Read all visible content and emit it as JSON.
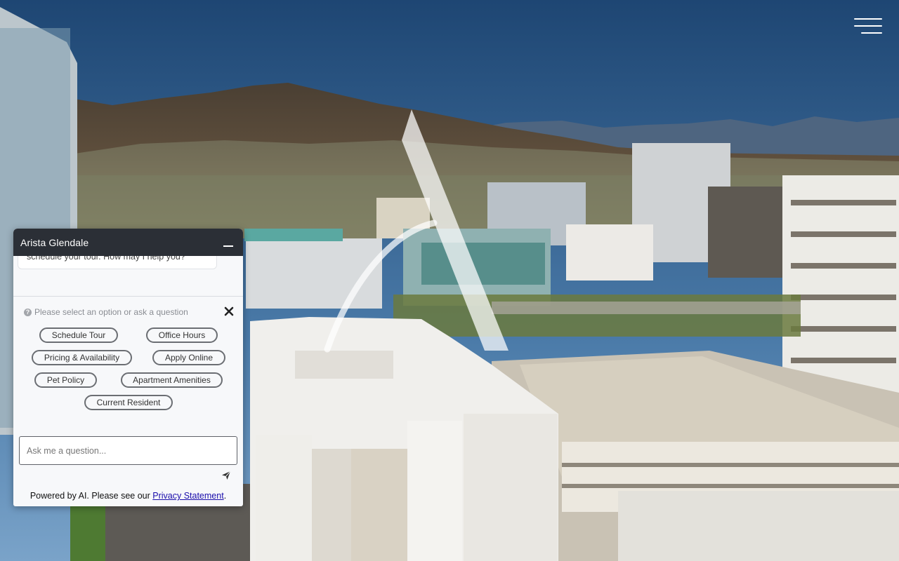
{
  "header": {
    "menu_icon": "hamburger-menu-icon"
  },
  "chat": {
    "title": "Arista Glendale",
    "minimize_icon": "minimize-icon",
    "transcript": {
      "last_message": "schedule your tour. How may I help you?"
    },
    "prompt": {
      "icon": "help-circle-icon",
      "text": "Please select an option or ask a question",
      "close_icon": "close-icon"
    },
    "options": [
      {
        "label": "Schedule Tour"
      },
      {
        "label": "Office Hours"
      },
      {
        "label": "Pricing & Availability"
      },
      {
        "label": "Apply Online"
      },
      {
        "label": "Pet Policy"
      },
      {
        "label": "Apartment Amenities"
      },
      {
        "label": "Current Resident"
      }
    ],
    "input": {
      "placeholder": "Ask me a question...",
      "value": ""
    },
    "send_icon": "send-icon",
    "footer": {
      "text": "Powered by AI. Please see our ",
      "link_label": "Privacy Statement",
      "suffix": "."
    }
  },
  "colors": {
    "chat_header_bg": "#2b2f36",
    "chip_border": "#6b6e73",
    "link": "#1a0dab",
    "sky_top": "#1f4a78",
    "sky_bottom": "#6f9ac4"
  }
}
